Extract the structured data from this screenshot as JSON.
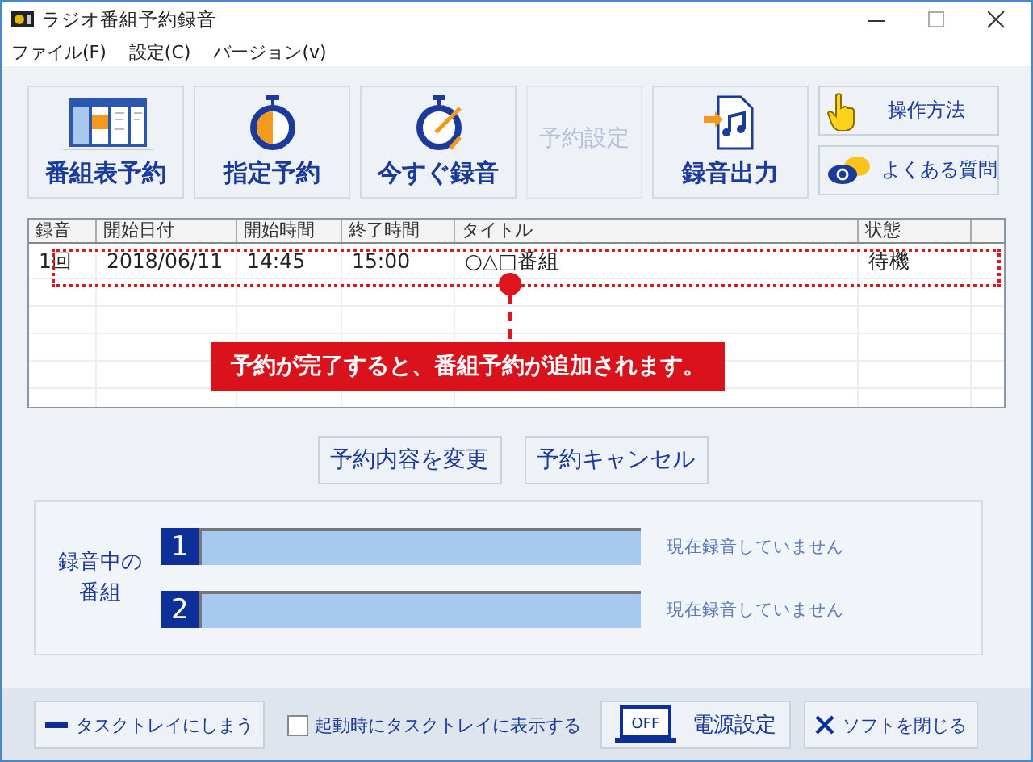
{
  "window": {
    "title": "ラジオ番組予約録音"
  },
  "menu": [
    "ファイル(F)",
    "設定(C)",
    "バージョン(v)"
  ],
  "toolbar": [
    {
      "label": "番組表予約",
      "disabled": false
    },
    {
      "label": "指定予約",
      "disabled": false
    },
    {
      "label": "今すぐ録音",
      "disabled": false
    },
    {
      "label": "予約設定",
      "disabled": true
    },
    {
      "label": "録音出力",
      "disabled": false
    }
  ],
  "help_buttons": [
    "操作方法",
    "よくある質問"
  ],
  "table": {
    "columns": [
      "録音",
      "開始日付",
      "開始時間",
      "終了時間",
      "タイトル",
      "状態"
    ],
    "rows": [
      {
        "cells": [
          "1回",
          "2018/06/11",
          "14:45",
          "15:00",
          "○△□番組",
          "待機"
        ]
      }
    ]
  },
  "callout": "予約が完了すると、番組予約が追加されます。",
  "actions": [
    "予約内容を変更",
    "予約キャンセル"
  ],
  "recording": {
    "label": "録音中の番組",
    "slots": [
      {
        "number": "1",
        "status": "現在録音していません"
      },
      {
        "number": "2",
        "status": "現在録音していません"
      }
    ]
  },
  "footer": {
    "tray_button": "タスクトレイにしまう",
    "startup_checkbox": {
      "label": "起動時にタスクトレイに表示する",
      "checked": false
    },
    "power_button": {
      "label": "電源設定",
      "icon_text": "OFF"
    },
    "close_button": "ソフトを閉じる"
  }
}
